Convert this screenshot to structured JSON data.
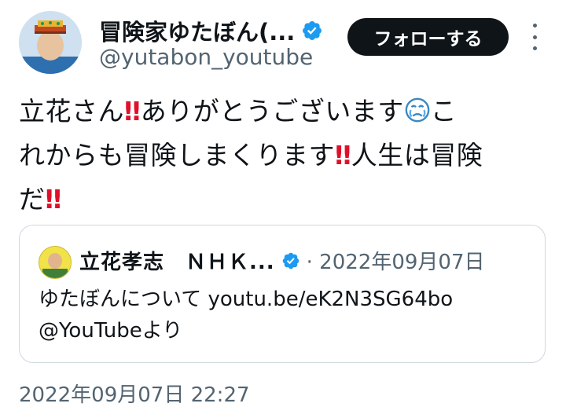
{
  "author": {
    "display_name": "冒険家ゆたぼん(...",
    "handle": "@yutabon_youtube"
  },
  "follow_label": "フォローする",
  "tweet": {
    "line1_a": "立花さん",
    "line1_b": "ありがとうございます",
    "line1_c": "こ",
    "line2_a": "れからも冒険しまくります",
    "line2_b": "人生は冒険",
    "line3_a": "だ",
    "bang": "‼"
  },
  "quote": {
    "author_name": "立花孝志　ＮＨＫ...",
    "meta": "· 2022年09月07日",
    "body_line1": "ゆたぼんについて youtu.be/eK2N3SG64bo",
    "body_line2": "@YouTubeより"
  },
  "timestamp": "2022年09月07日 22:27",
  "colors": {
    "verified_blue": "#1d9bf0",
    "follow_bg": "#0f1419",
    "secondary_text": "#536471",
    "emoji_red": "#e0102a"
  }
}
